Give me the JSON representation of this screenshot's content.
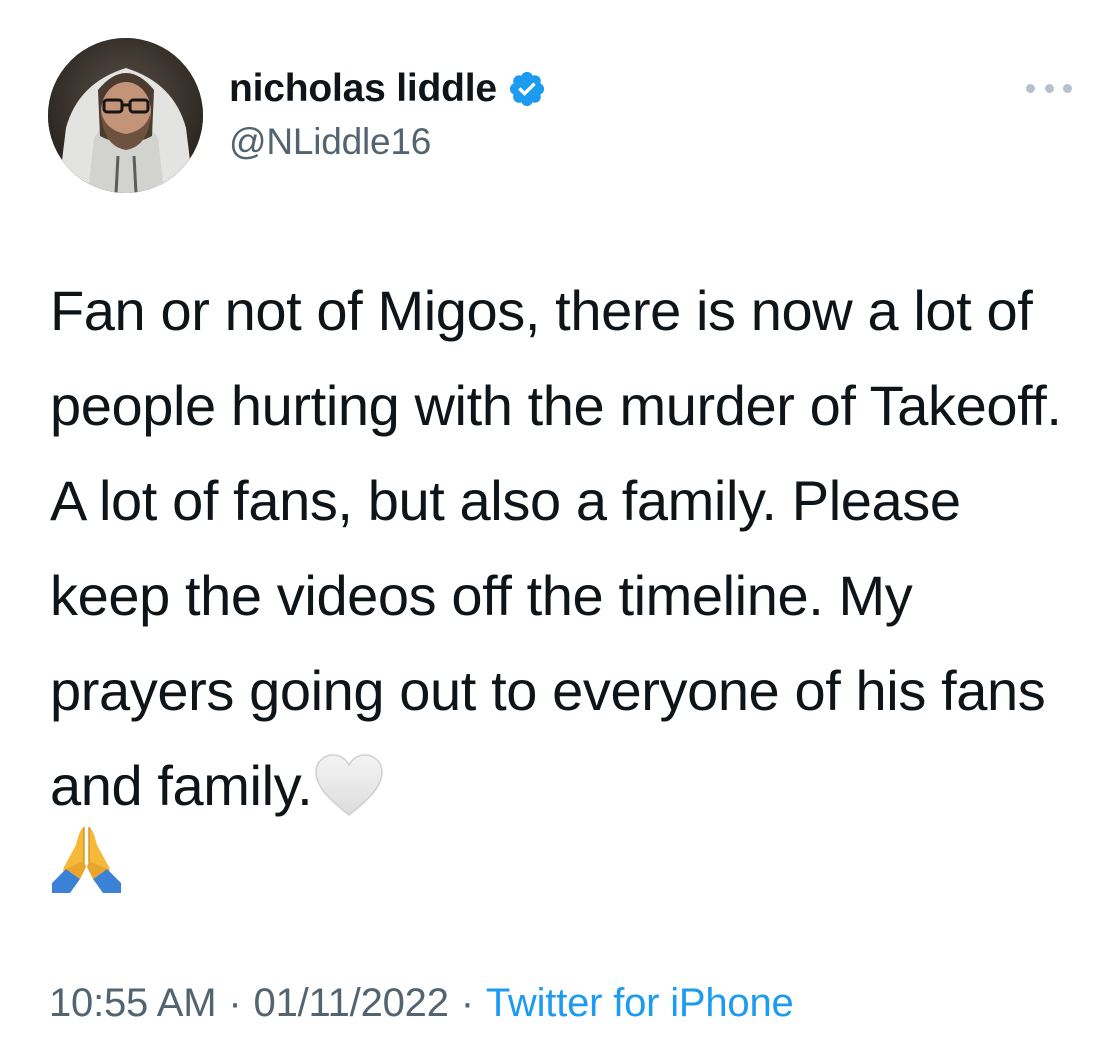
{
  "tweet": {
    "author": {
      "display_name": "nicholas liddle",
      "handle": "@NLiddle16",
      "verified": true,
      "verified_icon": "verified-badge-icon",
      "avatar_icon": "profile-photo"
    },
    "more_icon": "more-options-icon",
    "text": "Fan or not of Migos, there is now a lot of people hurting with the murder of Takeoff. A lot of fans, but also a family. Please keep the videos off the timeline. My prayers going out to everyone of his fans and family.",
    "emojis": [
      "white-heart-icon",
      "folded-hands-icon"
    ],
    "time": "10:55 AM",
    "separator": "·",
    "date": "01/11/2022",
    "source": "Twitter for iPhone"
  },
  "colors": {
    "text": "#0f1419",
    "secondary": "#536471",
    "link": "#1d9bf0",
    "verified": "#1d9bf0"
  }
}
